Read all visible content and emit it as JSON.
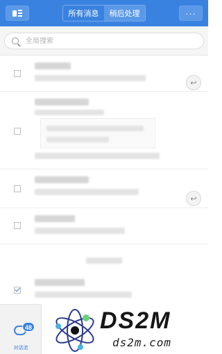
{
  "header": {
    "tabs": [
      {
        "label": "所有消息",
        "active": false
      },
      {
        "label": "稍后处理",
        "active": true
      }
    ],
    "more_label": "···"
  },
  "search": {
    "placeholder": "全局搜索"
  },
  "list": {
    "items": [
      {
        "checked": false,
        "has_reply": true
      },
      {
        "checked": false,
        "has_reply": false,
        "has_quote": true
      },
      {
        "checked": false,
        "has_reply": true
      },
      {
        "checked": false,
        "has_reply": false
      },
      {
        "checked": true,
        "has_reply": false
      }
    ]
  },
  "bottom_nav": {
    "label": "对话流",
    "badge": "48"
  },
  "watermark": {
    "title": "DS2M",
    "subtitle": "ds2m.com"
  },
  "colors": {
    "accent": "#3a82e0",
    "background": "#ffffff"
  }
}
